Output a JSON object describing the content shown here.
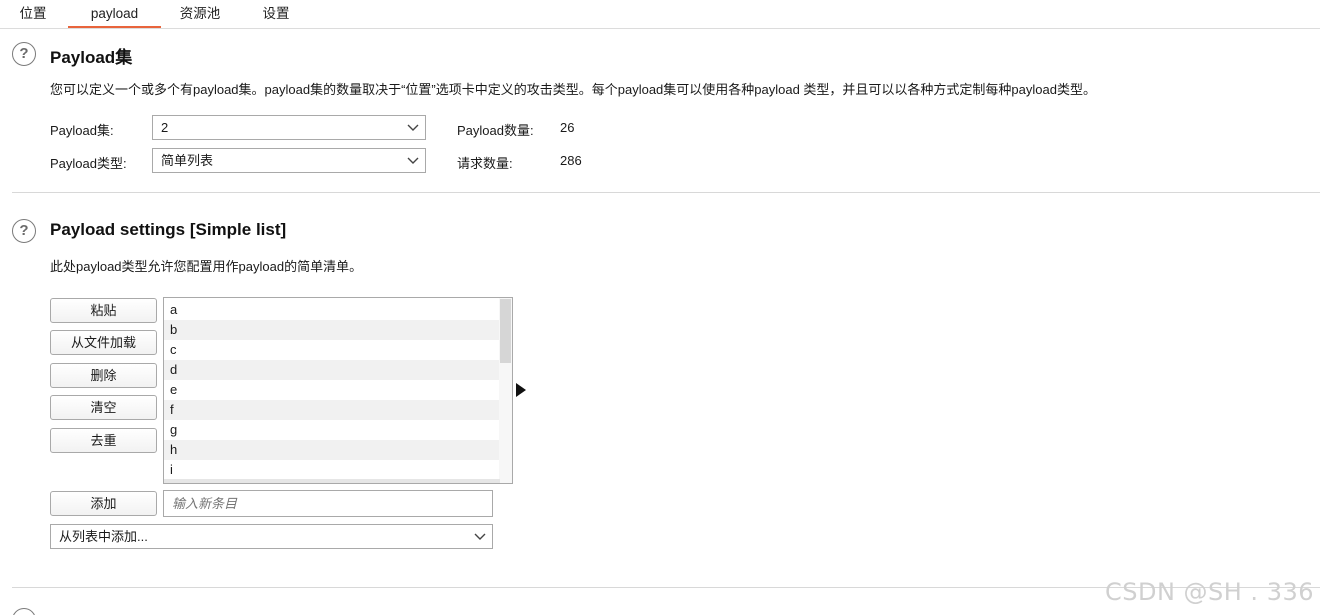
{
  "tabs": [
    "位置",
    "payload",
    "资源池",
    "设置"
  ],
  "payload_sets": {
    "title": "Payload集",
    "description": "您可以定义一个或多个有payload集。payload集的数量取决于“位置”选项卡中定义的攻击类型。每个payload集可以使用各种payload 类型，并且可以以各种方式定制每种payload类型。",
    "set_label": "Payload集:",
    "set_value": "2",
    "type_label": "Payload类型:",
    "type_value": "简单列表",
    "count_label": "Payload数量:",
    "count_value": "26",
    "request_label": "请求数量:",
    "request_value": "286"
  },
  "payload_settings": {
    "title": "Payload settings [Simple list]",
    "description": "此处payload类型允许您配置用作payload的简单清单。",
    "buttons": {
      "paste": "粘贴",
      "load": "从文件加载",
      "remove": "删除",
      "clear": "清空",
      "dedupe": "去重",
      "add": "添加"
    },
    "items": [
      "a",
      "b",
      "c",
      "d",
      "e",
      "f",
      "g",
      "h",
      "i"
    ],
    "new_item_placeholder": "输入新条目",
    "add_from_list": "从列表中添加..."
  },
  "watermark": "CSDN @SH       .  336",
  "icons": {
    "help": "help-icon",
    "dropdown": "chevron-down-icon",
    "expand": "play-arrow-icon"
  }
}
